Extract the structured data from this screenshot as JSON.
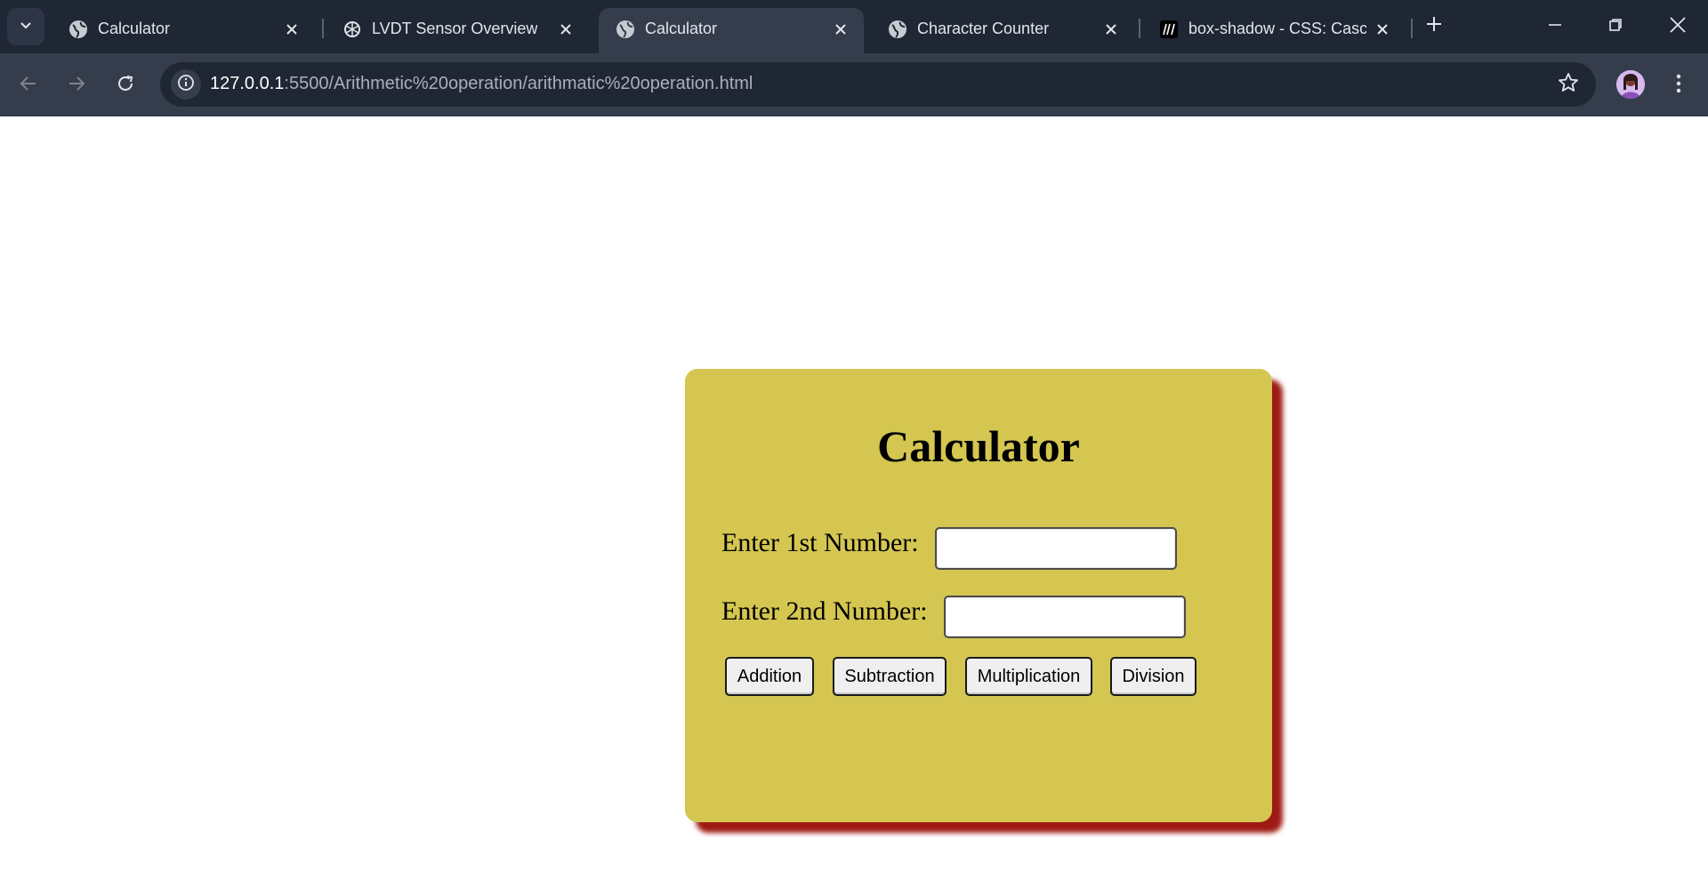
{
  "browser": {
    "tabs": [
      {
        "title": "Calculator",
        "icon": "globe-icon",
        "active": false
      },
      {
        "title": "LVDT Sensor Overview",
        "icon": "chatgpt-icon",
        "active": false
      },
      {
        "title": "Calculator",
        "icon": "globe-icon",
        "active": true
      },
      {
        "title": "Character Counter",
        "icon": "globe-icon",
        "active": false
      },
      {
        "title": "box-shadow - CSS: Casca",
        "icon": "mdn-icon",
        "active": false
      }
    ],
    "url_host": "127.0.0.1",
    "url_rest": ":5500/Arithmetic%20operation/arithmatic%20operation.html",
    "theme_color": "#1f2634",
    "toolbar_color": "#353d4d"
  },
  "page": {
    "title": "Calculator",
    "first_label": "Enter 1st Number:",
    "second_label": "Enter 2nd Number:",
    "first_value": "",
    "second_value": "",
    "buttons": {
      "addition": "Addition",
      "subtraction": "Subtraction",
      "multiplication": "Multiplication",
      "division": "Division"
    },
    "card_color": "#d4c650",
    "shadow_color": "#9e1a14"
  }
}
